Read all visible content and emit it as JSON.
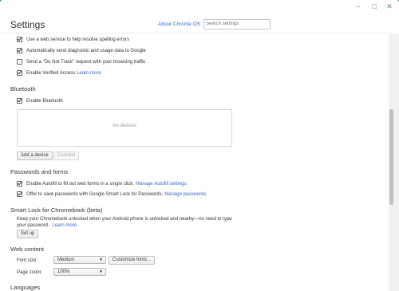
{
  "window": {
    "minimize_glyph": "–",
    "maximize_glyph": "□",
    "close_glyph": "✕"
  },
  "header": {
    "title": "Settings",
    "about_link": "About Chrome OS",
    "search_placeholder": "Search settings"
  },
  "privacy": {
    "items": [
      {
        "label": "Use a web service to help resolve spelling errors",
        "checked": true
      },
      {
        "label": "Automatically send diagnostic and usage data to Google",
        "checked": true
      },
      {
        "label": "Send a \"Do Not Track\" request with your browsing traffic",
        "checked": false
      },
      {
        "label": "Enable Verified Access",
        "checked": true,
        "link": "Learn more"
      }
    ]
  },
  "bluetooth": {
    "heading": "Bluetooth",
    "enable_label": "Enable Bluetooth",
    "enabled": true,
    "no_devices": "No devices",
    "add_device": "Add a device",
    "connect": "Connect"
  },
  "passwords": {
    "heading": "Passwords and forms",
    "autofill_label": "Enable Autofill to fill out web forms in a single click.",
    "autofill_link": "Manage Autofill settings",
    "save_label": "Offer to save passwords with Google Smart Lock for Passwords.",
    "save_link": "Manage passwords"
  },
  "smart_lock": {
    "heading": "Smart Lock for Chromebook (beta)",
    "description": "Keep your Chromebook unlocked when your Android phone is unlocked and nearby—no need to type your password.",
    "learn_more": "Learn more",
    "setup": "Set up"
  },
  "web_content": {
    "heading": "Web content",
    "font_size_label": "Font size:",
    "font_size_value": "Medium",
    "customize_fonts": "Customize fonts...",
    "page_zoom_label": "Page zoom:",
    "page_zoom_value": "100%"
  },
  "languages": {
    "heading": "Languages"
  },
  "colors": {
    "accent_link": "#3367d6",
    "desktop": "#2e8b8a"
  }
}
